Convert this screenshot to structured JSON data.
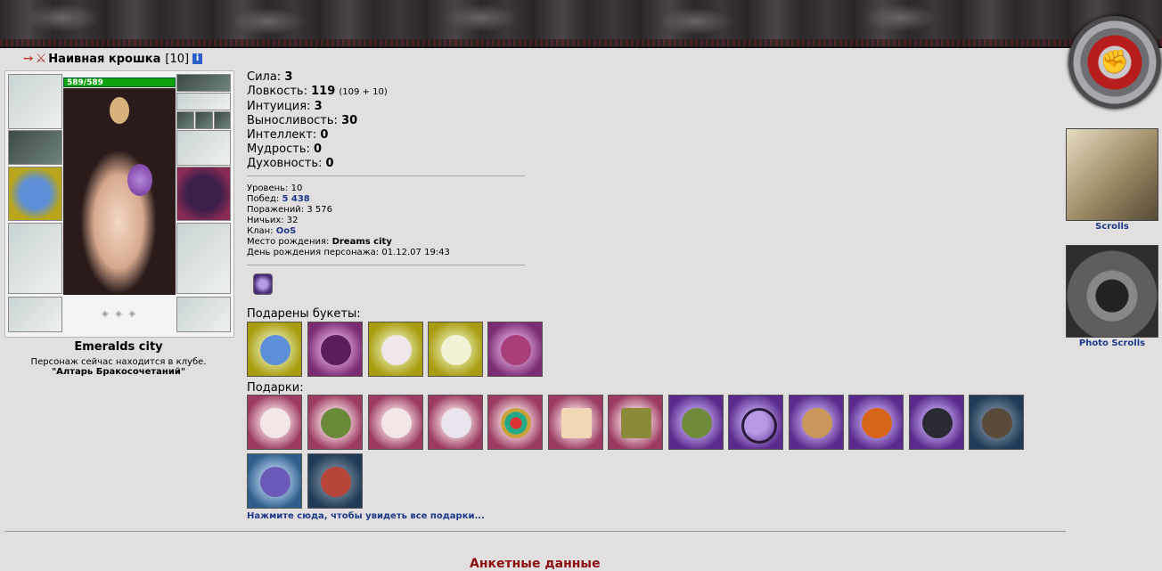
{
  "character": {
    "name": "Наивная крошка",
    "level": "[10]",
    "hp": "589/589",
    "city": "Emeralds city",
    "status_note": "Персонаж сейчас находится в клубе.",
    "club_location": "\"Алтарь Бракосочетаний\""
  },
  "stats": {
    "strength_label": "Сила:",
    "strength": "3",
    "agility_label": "Ловкость:",
    "agility": "119",
    "agility_detail": "(109 + 10)",
    "intuition_label": "Интуиция:",
    "intuition": "3",
    "stamina_label": "Выносливость:",
    "stamina": "30",
    "intellect_label": "Интеллект:",
    "intellect": "0",
    "wisdom_label": "Мудрость:",
    "wisdom": "0",
    "spirit_label": "Духовность:",
    "spirit": "0"
  },
  "info": {
    "level_label": "Уровень:",
    "level": "10",
    "wins_label": "Побед:",
    "wins": "5 438",
    "losses_label": "Поражений:",
    "losses": "3 576",
    "draws_label": "Ничьих:",
    "draws": "32",
    "clan_label": "Клан:",
    "clan": "OoS",
    "birthplace_label": "Место рождения:",
    "birthplace": "Dreams city",
    "birthday_label": "День рождения персонажа:",
    "birthday": "01.12.07 19:43"
  },
  "bouquets_label": "Подарены букеты:",
  "gifts_label": "Подарки:",
  "more_gifts_link": "Нажмите сюда, чтобы увидеть все подарки...",
  "section_title": "Анкетные данные",
  "scrolls": {
    "scrolls_label": "Scrolls",
    "photo_label": "Photo Scrolls"
  },
  "icons": [
    "arrow-icon",
    "swords-icon",
    "info-icon",
    "clan-badge-icon"
  ]
}
